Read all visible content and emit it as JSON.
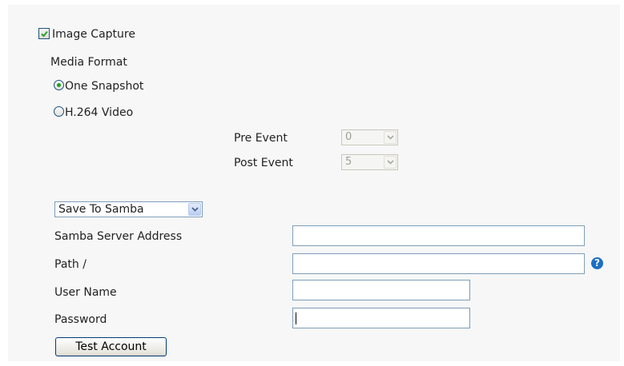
{
  "image_capture": {
    "label": "Image Capture",
    "checked": true
  },
  "media_format": {
    "label": "Media Format",
    "options": [
      {
        "label": "One Snapshot",
        "selected": true
      },
      {
        "label": "H.264 Video",
        "selected": false
      }
    ]
  },
  "event": {
    "pre_label": "Pre Event",
    "pre_value": "0",
    "post_label": "Post Event",
    "post_value": "5"
  },
  "save_target": {
    "selected": "Save To Samba"
  },
  "samba": {
    "server_label": "Samba Server Address",
    "server_value": "",
    "path_label": "Path /",
    "path_value": "",
    "user_label": "User Name",
    "user_value": "",
    "password_label": "Password",
    "password_value": ""
  },
  "test_button": {
    "label": "Test Account"
  },
  "help_icon": {
    "glyph": "?"
  },
  "colors": {
    "check_mark": "#2ea02e",
    "radio_dot": "#21a121",
    "help_icon": "#1b6fc4",
    "input_border": "#7f9db9"
  }
}
